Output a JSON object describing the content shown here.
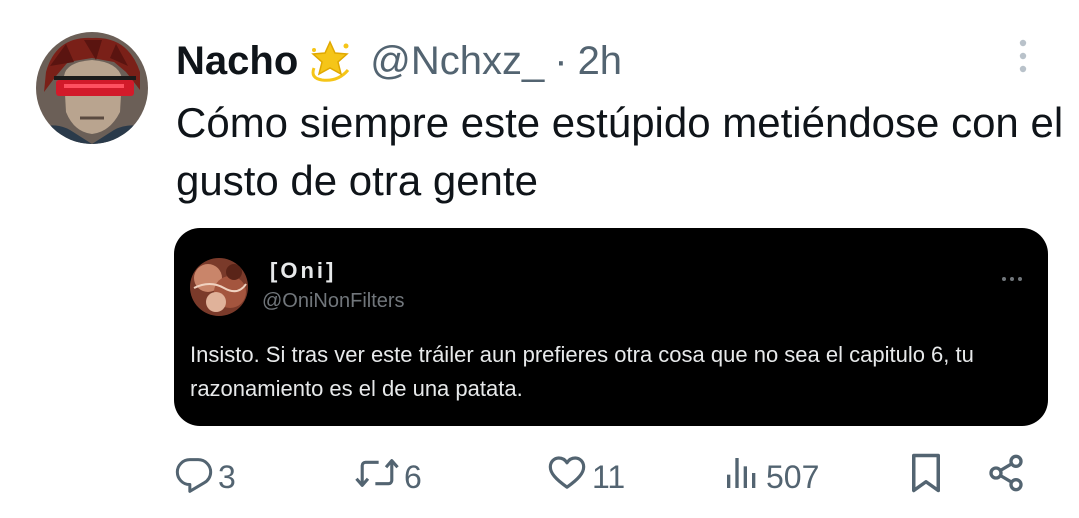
{
  "tweet": {
    "author_name": "Nacho",
    "emoji": "dizzy-star-icon",
    "handle": "@Nchxz_",
    "separator": "·",
    "time": "2h",
    "text": "Cómo siempre este estúpido metiéndose con el gusto de otra gente"
  },
  "quote": {
    "author_name": "[Oni]",
    "handle": "@OniNonFilters",
    "text": "Insisto. Si tras ver este tráiler aun prefieres otra cosa que no sea el capitulo 6, tu razonamiento es el de una patata."
  },
  "actions": {
    "replies": "3",
    "retweets": "6",
    "likes": "11",
    "views": "507"
  },
  "colors": {
    "text_primary": "#0f1419",
    "text_secondary": "#536471",
    "quote_background": "#000000",
    "quote_text": "#e7e9ea",
    "quote_secondary": "#71767b",
    "emoji_star": "#f5c518"
  }
}
